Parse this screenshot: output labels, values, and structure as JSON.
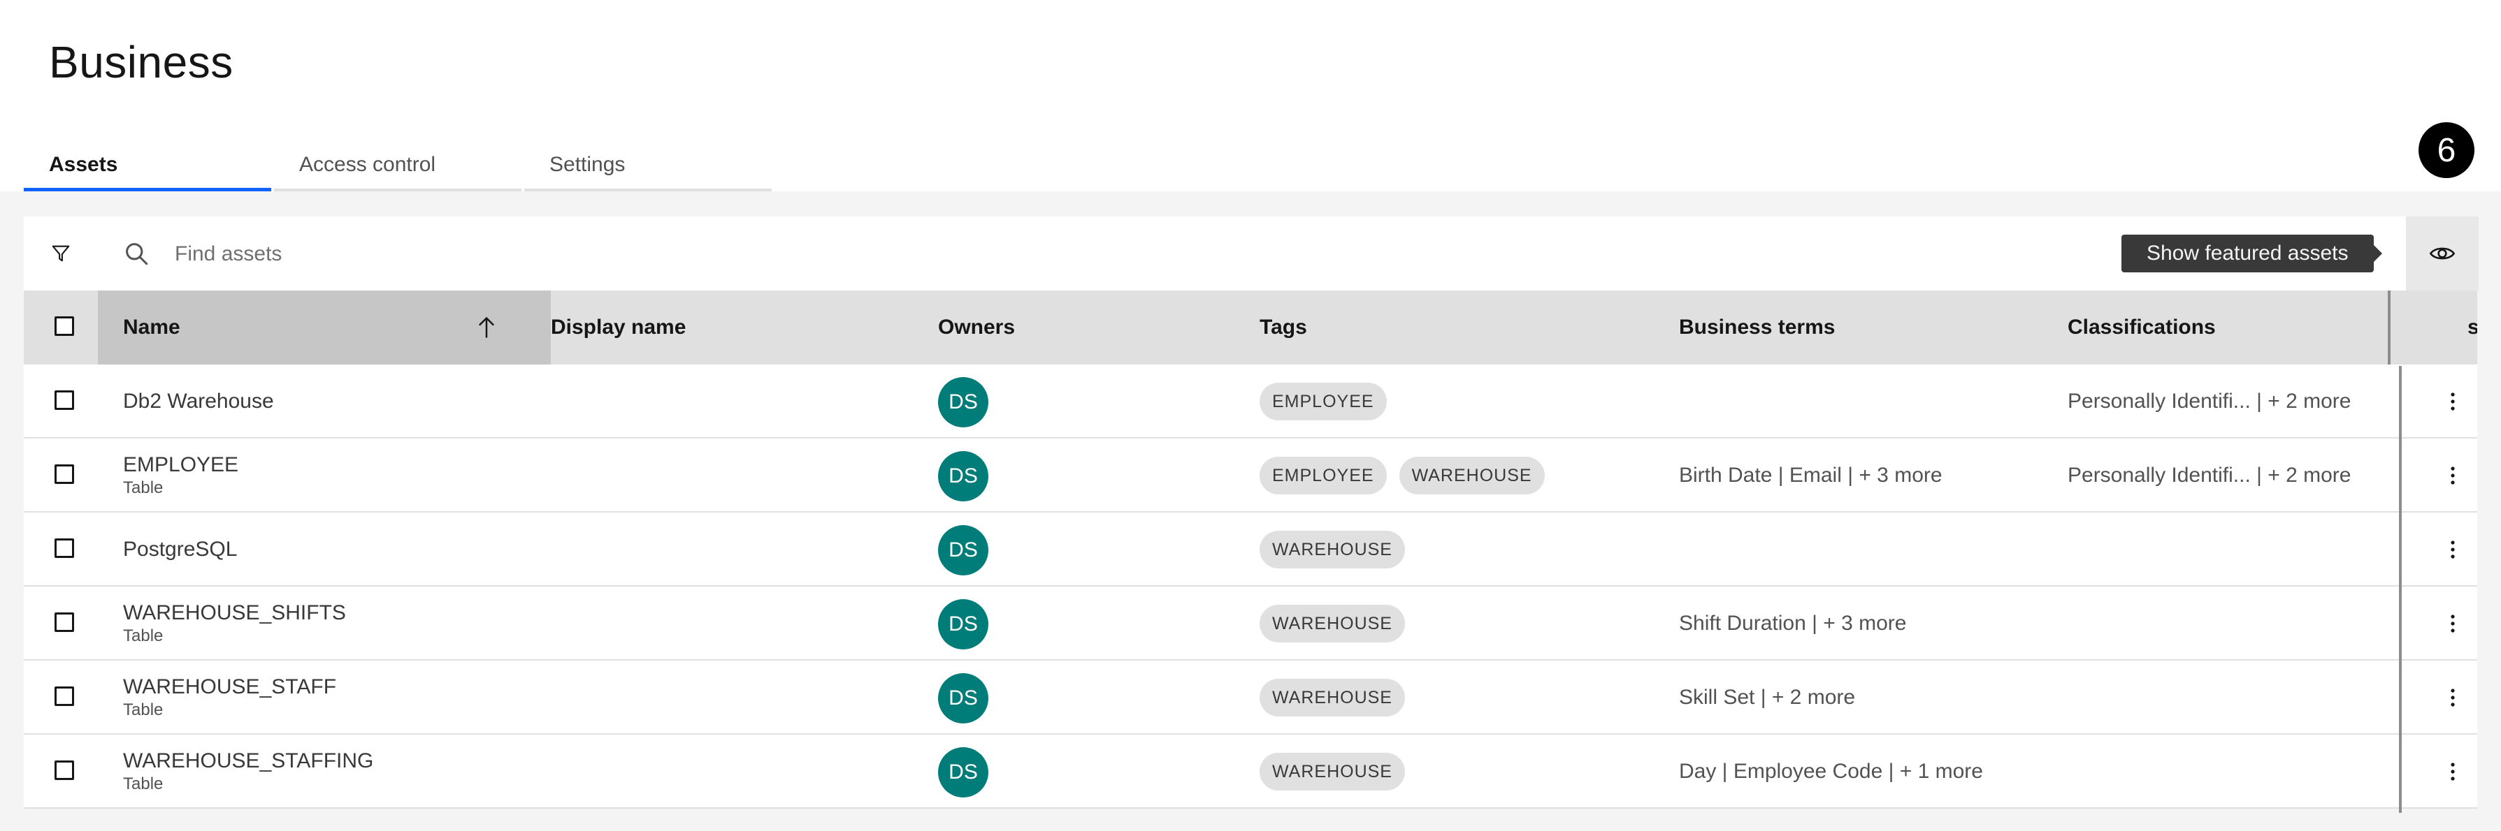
{
  "page": {
    "title": "Business"
  },
  "tabs": [
    {
      "label": "Assets",
      "active": true
    },
    {
      "label": "Access control",
      "active": false
    },
    {
      "label": "Settings",
      "active": false
    }
  ],
  "step_badge": "6",
  "toolbar": {
    "search_placeholder": "Find assets",
    "tooltip": "Show featured assets"
  },
  "table": {
    "columns": [
      "Name",
      "Display name",
      "Owners",
      "Tags",
      "Business terms",
      "Classifications",
      "s"
    ],
    "rows": [
      {
        "name": "Db2 Warehouse",
        "type": "",
        "owner": "DS",
        "tags": [
          "EMPLOYEE"
        ],
        "business_terms": "",
        "classifications": "Personally Identifi... | + 2 more"
      },
      {
        "name": "EMPLOYEE",
        "type": "Table",
        "owner": "DS",
        "tags": [
          "EMPLOYEE",
          "WAREHOUSE"
        ],
        "business_terms": "Birth Date | Email | + 3 more",
        "classifications": "Personally Identifi... | + 2 more"
      },
      {
        "name": "PostgreSQL",
        "type": "",
        "owner": "DS",
        "tags": [
          "WAREHOUSE"
        ],
        "business_terms": "",
        "classifications": ""
      },
      {
        "name": "WAREHOUSE_SHIFTS",
        "type": "Table",
        "owner": "DS",
        "tags": [
          "WAREHOUSE"
        ],
        "business_terms": "Shift Duration | + 3 more",
        "classifications": ""
      },
      {
        "name": "WAREHOUSE_STAFF",
        "type": "Table",
        "owner": "DS",
        "tags": [
          "WAREHOUSE"
        ],
        "business_terms": "Skill Set | + 2 more",
        "classifications": ""
      },
      {
        "name": "WAREHOUSE_STAFFING",
        "type": "Table",
        "owner": "DS",
        "tags": [
          "WAREHOUSE"
        ],
        "business_terms": "Day | Employee Code | + 1 more",
        "classifications": ""
      }
    ]
  },
  "colors": {
    "accent": "#0f62fe",
    "avatar": "#007d79",
    "tooltip_bg": "#393939"
  }
}
